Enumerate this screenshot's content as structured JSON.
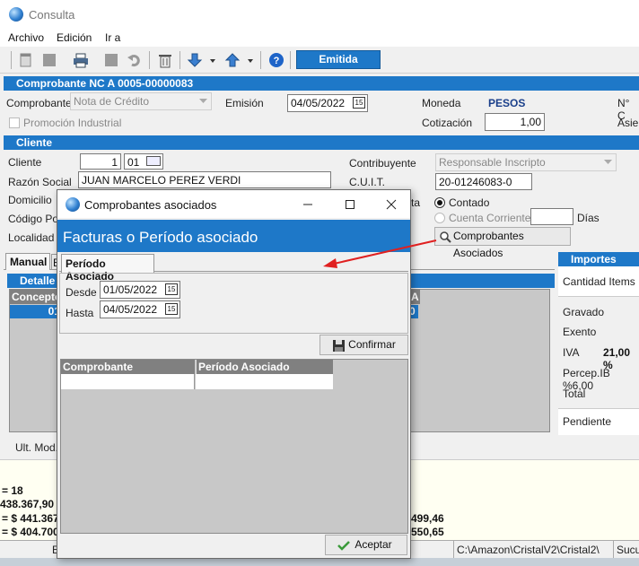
{
  "window": {
    "title": "Consulta"
  },
  "menu": [
    "Archivo",
    "Edición",
    "Ir a"
  ],
  "toolbar": {
    "status_label": "Emitida"
  },
  "comprobante": {
    "section_title": "Comprobante NC A 0005-00000083",
    "label": "Comprobante",
    "value": "Nota de Crédito",
    "emision_label": "Emisión",
    "emision_value": "04/05/2022",
    "moneda_label": "Moneda",
    "moneda_value": "PESOS",
    "nc_label": "N° C",
    "promocion_label": "Promoción Industrial",
    "cotizacion_label": "Cotización",
    "cotizacion_value": "1,00",
    "asiento_label": "Asien"
  },
  "cliente": {
    "section_title": "Cliente",
    "cliente_label": "Cliente",
    "cliente_num": "1",
    "cliente_code": "01",
    "razon_label": "Razón Social",
    "razon_value": "JUAN MARCELO PEREZ VERDI",
    "domicilio_label": "Domicilio",
    "cp_label": "Código Post",
    "localidad_label": "Localidad IE",
    "contribuyente_label": "Contribuyente",
    "contribuyente_value": "Responsable Inscripto",
    "cuit_label": "C.U.I.T.",
    "cuit_value": "20-01246083-0",
    "cond_partial": "ta",
    "contado_label": "Contado",
    "cuenta_label": "Cuenta Corriente",
    "dias_label": "Días",
    "comp_asociados_button": "Comprobantes Asociados"
  },
  "lower": {
    "tab_manual": "Manual",
    "tab_partial": "E",
    "detalle_title": "Detalle",
    "col_concepto": "Concepto",
    "row_value": "01",
    "right_partial_col": "A",
    "right_partial_val": "0",
    "ult_mod_label": "Ult. Mod.:",
    "importes_title": "Importes",
    "cantidad_items": "Cantidad Items",
    "gravado": "Gravado",
    "exento": "Exento",
    "iva_label": "IVA",
    "iva_value": "21,00 %",
    "percep_label": "Percep.IB %6,00",
    "total_label": "Total",
    "pendiente_label": "Pendiente"
  },
  "bottom_lines": [
    "= 18",
    "438.367,90",
    "= $ 441.367,",
    "= $ 404.700,"
  ],
  "bottom_right": [
    "499,46",
    "550,65"
  ],
  "status_bar": {
    "e": "E",
    "path": "C:\\Amazon\\CristalV2\\Cristal2\\",
    "sucu": "Sucu"
  },
  "dialog": {
    "title": "Comprobantes asociados",
    "header": "Facturas o Período asociado",
    "tab": "Período Asociado",
    "desde_label": "Desde",
    "desde_value": "01/05/2022",
    "hasta_label": "Hasta",
    "hasta_value": "04/05/2022",
    "confirmar_button": "Confirmar",
    "col_comprobante": "Comprobante",
    "col_periodo": "Período Asociado",
    "aceptar_button": "Aceptar"
  },
  "colors": {
    "accent": "#1e78c8",
    "highlight": "#1e78c8",
    "annotation_arrow": "#e02020"
  }
}
